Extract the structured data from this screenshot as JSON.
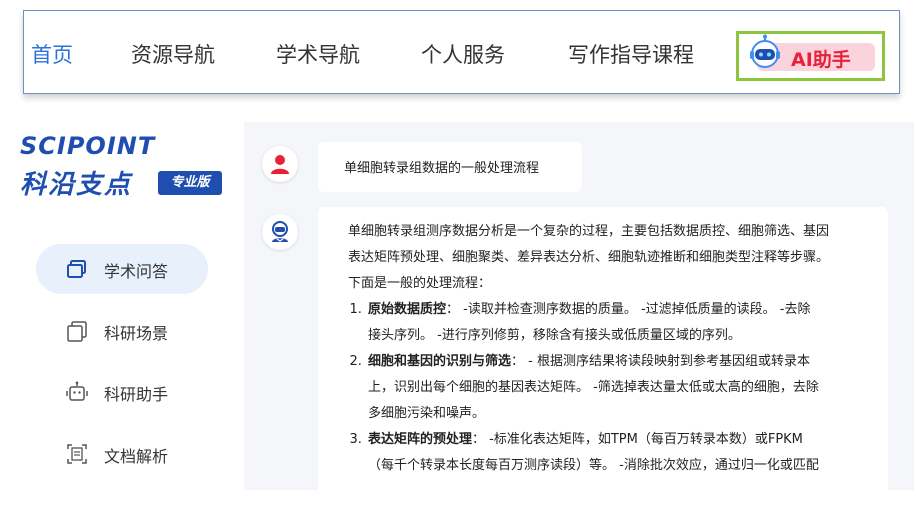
{
  "nav": {
    "items": [
      {
        "label": "首页",
        "active": true
      },
      {
        "label": "资源导航",
        "active": false
      },
      {
        "label": "学术导航",
        "active": false
      },
      {
        "label": "个人服务",
        "active": false
      },
      {
        "label": "写作指导课程",
        "active": false
      }
    ],
    "ai_button": {
      "label": "AI助手",
      "icon": "robot-icon"
    }
  },
  "brand": {
    "name_en": "SCIPOINT",
    "name_cn": "科沿支点",
    "badge": "专业版"
  },
  "sidebar": {
    "items": [
      {
        "label": "学术问答",
        "icon": "chat-window-icon",
        "active": true
      },
      {
        "label": "科研场景",
        "icon": "layers-icon",
        "active": false
      },
      {
        "label": "科研助手",
        "icon": "robot-outline-icon",
        "active": false
      },
      {
        "label": "文档解析",
        "icon": "document-scan-icon",
        "active": false
      }
    ]
  },
  "chat": {
    "user_question": "单细胞转录组数据的一般处理流程",
    "answer": {
      "intro_1": "单细胞转录组测序数据分析是一个复杂的过程，主要包括数据质控、细胞筛选、基因",
      "intro_2": "表达矩阵预处理、细胞聚类、差异表达分析、细胞轨迹推断和细胞类型注释等步骤。",
      "intro_3": "下面是一般的处理流程：",
      "steps": [
        {
          "title": "原始数据质控",
          "line1": "：  -读取并检查测序数据的质量。  -过滤掉低质量的读段。  -去除",
          "line2": "接头序列。  -进行序列修剪，移除含有接头或低质量区域的序列。"
        },
        {
          "title": "细胞和基因的识别与筛选",
          "line1": "：  - 根据测序结果将读段映射到参考基因组或转录本",
          "line2": "上，识别出每个细胞的基因表达矩阵。  -筛选掉表达量太低或太高的细胞，去除",
          "line3": "多细胞污染和噪声。"
        },
        {
          "title": "表达矩阵的预处理",
          "line1": "：  -标准化表达矩阵，如TPM（每百万转录本数）或FPKM",
          "line2": "（每千个转录本长度每百万测序读段）等。  -消除批次效应，通过归一化或匹配"
        }
      ]
    }
  },
  "colors": {
    "accent": "#2b6fe0",
    "brand": "#1f4db0",
    "ai_red": "#e8213a",
    "ai_pill": "#fbd3dc",
    "highlight_border": "#8cc63f",
    "sidebar_active": "#e8f0fc",
    "user_avatar": "#e8213a",
    "ai_avatar": "#1f4db0"
  }
}
